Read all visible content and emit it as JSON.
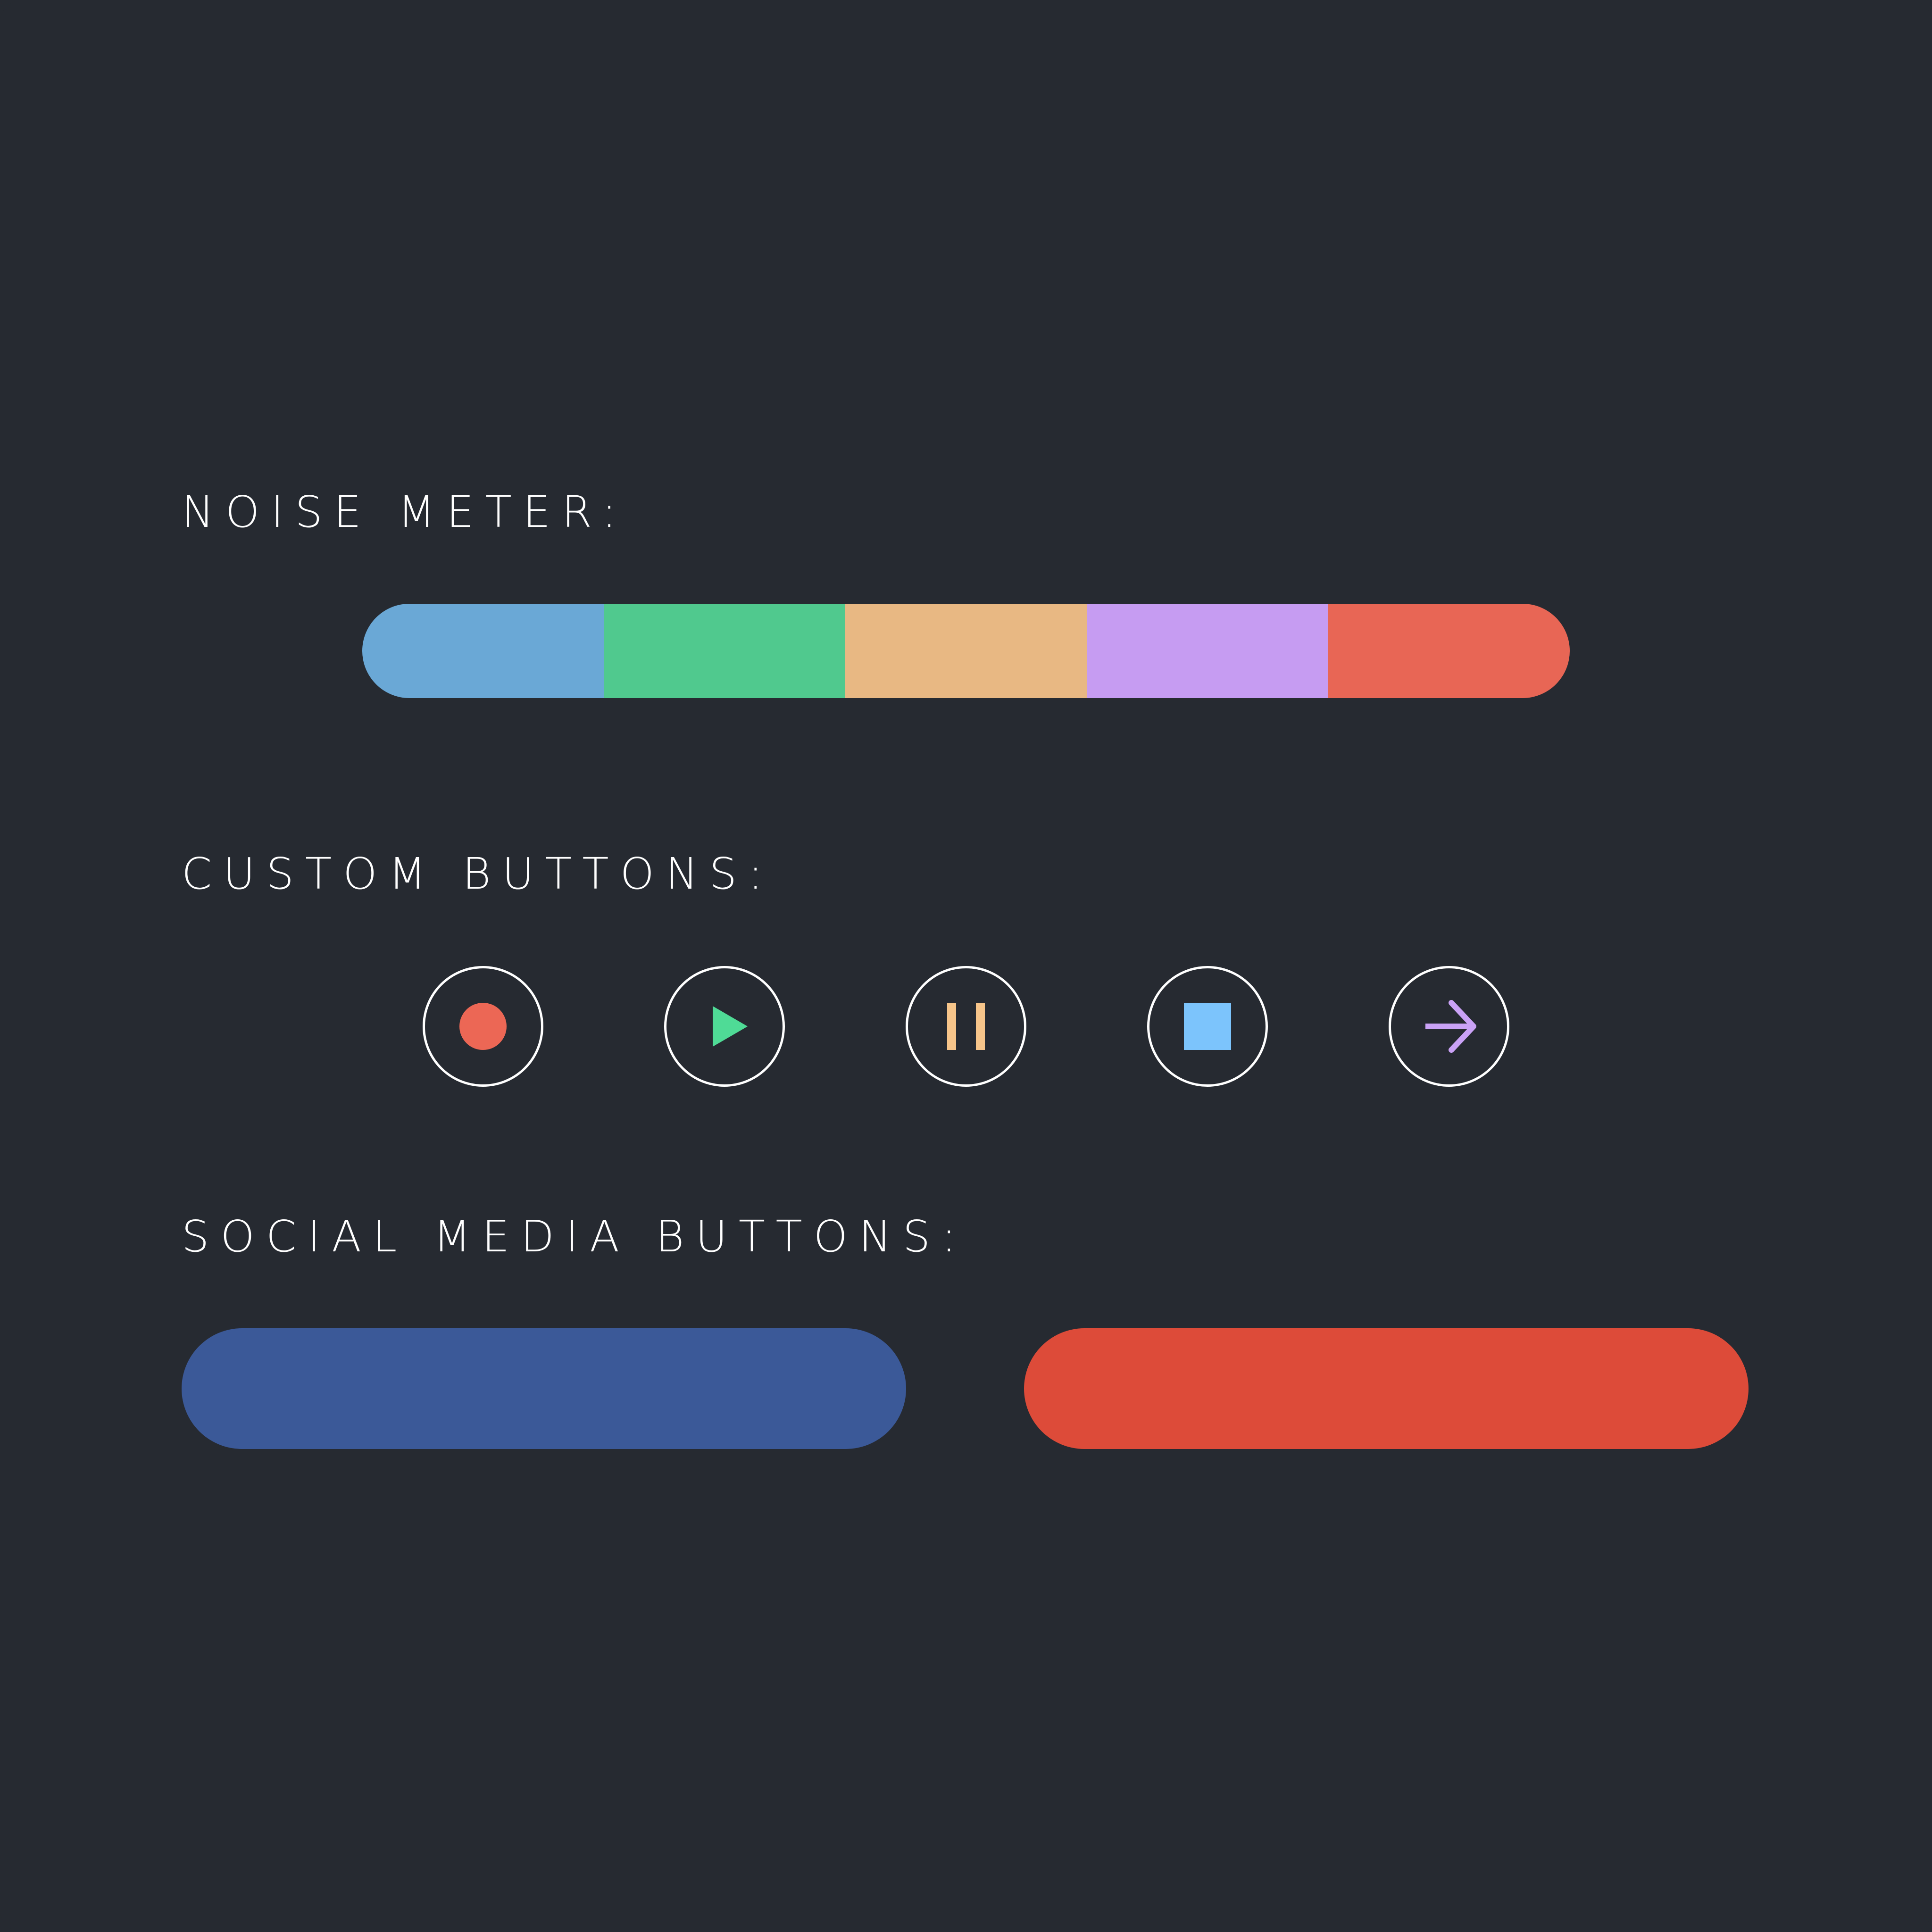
{
  "labels": {
    "noise_meter": "NOISE METER:",
    "custom_buttons": "CUSTOM BUTTONS:",
    "social_media_buttons": "SOCIAL MEDIA BUTTONS:"
  },
  "colors": {
    "background": "#262a31",
    "label_text": "#ffffff",
    "button_ring": "#ffffff"
  },
  "noise_meter": {
    "segments": [
      {
        "color": "#6aa8d6"
      },
      {
        "color": "#50c98e"
      },
      {
        "color": "#e8b883"
      },
      {
        "color": "#c69cf2"
      },
      {
        "color": "#e86655"
      }
    ]
  },
  "custom_buttons": [
    {
      "icon": "record-icon",
      "color": "#ec6755"
    },
    {
      "icon": "play-icon",
      "color": "#4fdb96"
    },
    {
      "icon": "pause-icon",
      "color": "#f7c58a"
    },
    {
      "icon": "stop-icon",
      "color": "#7cc4fc"
    },
    {
      "icon": "arrow-right-icon",
      "color": "#caa2f6"
    }
  ],
  "social_media_buttons": [
    {
      "color": "#3b5998"
    },
    {
      "color": "#dd4b39"
    }
  ]
}
